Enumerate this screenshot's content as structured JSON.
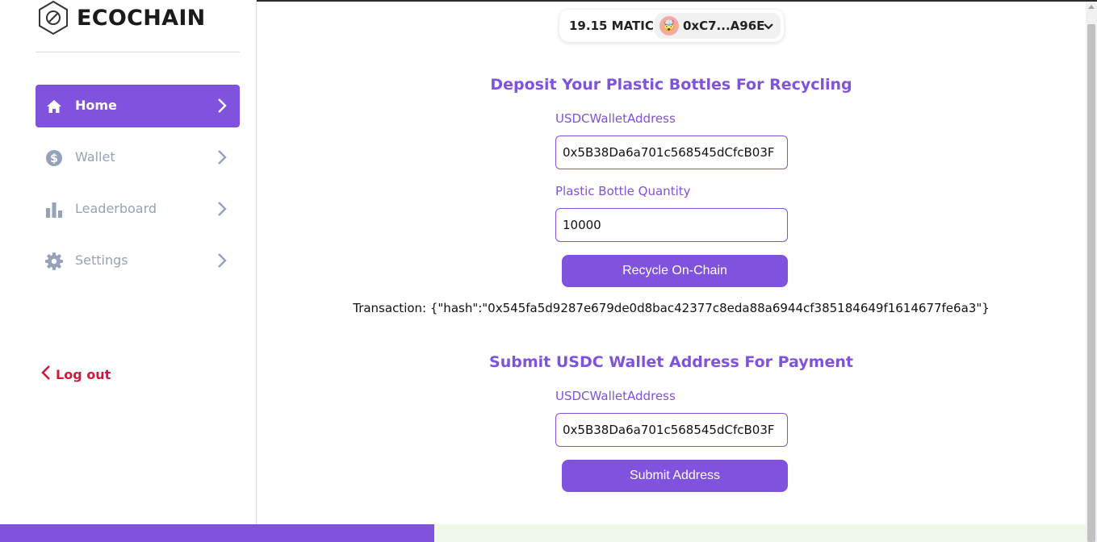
{
  "brand": {
    "name": "ECOCHAIN"
  },
  "sidebar": {
    "items": [
      {
        "label": "Home",
        "icon": "home-icon",
        "active": true
      },
      {
        "label": "Wallet",
        "icon": "dollar-coin-icon",
        "active": false
      },
      {
        "label": "Leaderboard",
        "icon": "bar-chart-icon",
        "active": false
      },
      {
        "label": "Settings",
        "icon": "gear-icon",
        "active": false
      }
    ],
    "logout_label": "Log out"
  },
  "wallet": {
    "balance": "19.15 MATIC",
    "address": "0xC7...A96E",
    "avatar": "🤯"
  },
  "deposit": {
    "title": "Deposit Your Plastic Bottles For Recycling",
    "address_label": "USDCWalletAddress",
    "address_value": "0x5B38Da6a701c568545dCfcB03F",
    "quantity_label": "Plastic Bottle Quantity",
    "quantity_value": "10000",
    "button_label": "Recycle On-Chain"
  },
  "transaction": {
    "text": "Transaction: {\"hash\":\"0x545fa5d9287e679de0d8bac42377c8eda88a6944cf385184649f1614677fe6a3\"}"
  },
  "submit": {
    "title": "Submit USDC Wallet Address For Payment",
    "address_label": "USDCWalletAddress",
    "address_value": "0x5B38Da6a701c568545dCfcB03F",
    "button_label": "Submit Address"
  },
  "progress": {
    "fraction": 0.4
  },
  "colors": {
    "accent": "#8052dd",
    "muted": "#94a3b8",
    "logout": "#d0183a"
  }
}
